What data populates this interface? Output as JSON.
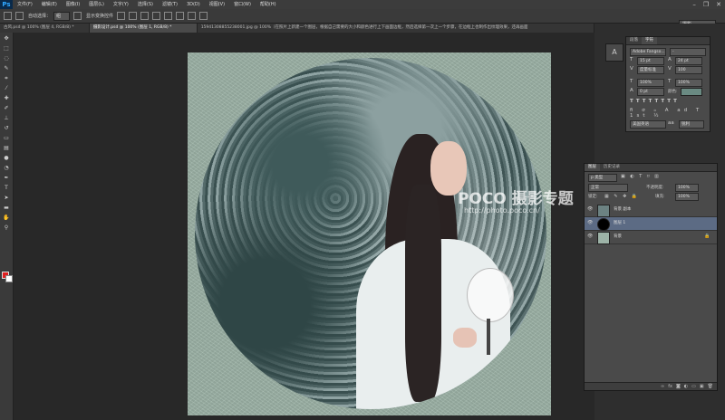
{
  "app": {
    "logo": "Ps",
    "window_controls": [
      "–",
      "❐",
      "✕"
    ]
  },
  "menu": [
    "文件(F)",
    "编辑(E)",
    "图像(I)",
    "图层(L)",
    "文字(Y)",
    "选择(S)",
    "滤镜(T)",
    "3D(D)",
    "视图(V)",
    "窗口(W)",
    "帮助(H)"
  ],
  "options_bar": {
    "auto_select_label": "自动选择：",
    "auto_select_value": "组",
    "transform_label": "显示变换控件",
    "workspace": "摄影"
  },
  "tabs": [
    {
      "label": "古风.psd @ 100% (图层 4, RGB/8) *",
      "active": false
    },
    {
      "label": "摄影设计.psd @ 100% (图层 1, RGB/8) *",
      "active": true
    },
    {
      "label": "15941308855238001.jpg @ 100%（在照片上新建一个图层，根据自己需要的大小和颜色进行上下画面边框，然后选择第一次上一个步骤，在边框上也制作出纹理效果，还再画面",
      "active": false
    }
  ],
  "watermark": {
    "logo": "POCO 摄影专题",
    "url": "http://photo.poco.cn/"
  },
  "character_panel": {
    "tabs": [
      "段落",
      "字符"
    ],
    "font_family": "Adobe Fangso...",
    "font_style": "-",
    "font_size": "15 pt",
    "leading": "24 pt",
    "kerning": "度量标准",
    "tracking": "100",
    "vscale": "100%",
    "hscale": "100%",
    "baseline": "0 pt",
    "color_label": "颜色:",
    "color": "#6a8a82",
    "language": "美国英语",
    "antialias": "锐利"
  },
  "layers_panel": {
    "tabs": [
      "图层",
      "历史记录"
    ],
    "kind_label": "p 类型",
    "blend_mode": "正常",
    "opacity_label": "不透明度:",
    "opacity": "100%",
    "lock_label": "锁定:",
    "fill_label": "填充:",
    "fill": "100%",
    "layers": [
      {
        "name": "背景 副本",
        "selected": false
      },
      {
        "name": "图层 1",
        "selected": true
      },
      {
        "name": "背景",
        "selected": false
      }
    ]
  }
}
